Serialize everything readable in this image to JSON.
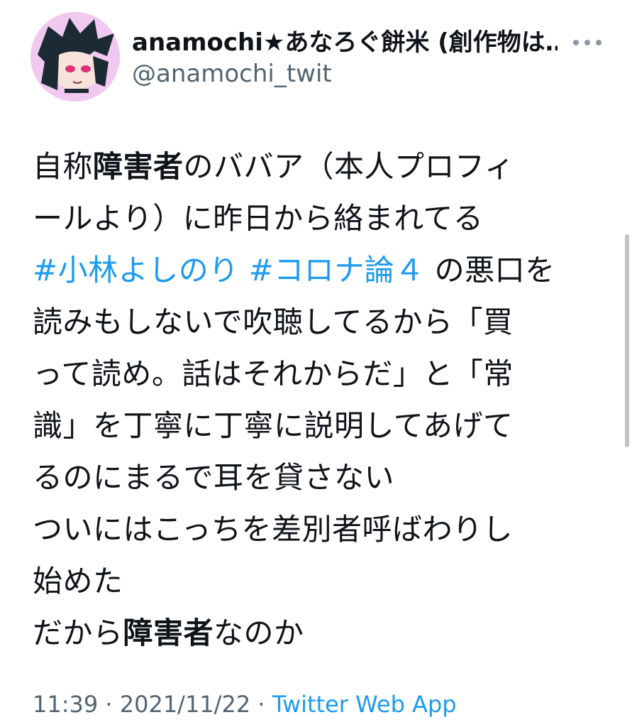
{
  "tweet": {
    "display_name": "anamochi★あなろぐ餅米 (創作物は…",
    "handle": "@anamochi_twit",
    "lines": [
      {
        "a": "自称",
        "b": "障害者",
        "c": "のババア（本人プロフィ"
      },
      {
        "a": "ール",
        "b2": "より）に昨日から絡まれてる"
      },
      {
        "h1": "#小林よしのり",
        "h2": "#コロナ論４",
        "d": "の悪口を"
      },
      {
        "e": "読みもしないで吹聴してるから「買"
      },
      {
        "f": "って読め。話はそれからだ」と「常"
      },
      {
        "g": "識」を丁寧に丁寧に説明してあげて"
      },
      {
        "i": "るのにまるで耳を貸さない"
      },
      {
        "j": "ついにはこっちを差別者呼ばわりし"
      },
      {
        "k": "始めた"
      },
      {
        "l": "だから",
        "m": "障害者",
        "n": "なのか"
      }
    ],
    "time": "11:39",
    "sep1": "·",
    "date": "2021/11/22",
    "sep2": "·",
    "source": "Twitter Web App"
  },
  "icons": {
    "more": "more-horizontal-icon",
    "avatar": "avatar-image"
  },
  "colors": {
    "link": "#1d9bf0",
    "secondary_text": "#536471",
    "text": "#0f1419"
  }
}
